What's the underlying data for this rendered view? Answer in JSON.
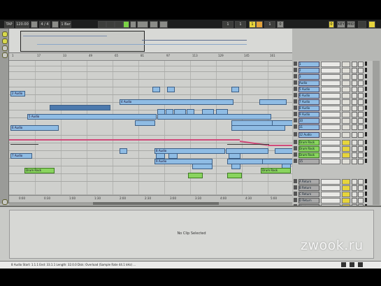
{
  "topbar": {
    "buttons_left": [
      "TAP",
      "120.00",
      "",
      "4 / 4",
      "",
      "1 Bar",
      "",
      "",
      ""
    ],
    "buttons_mid": [
      "",
      "",
      "",
      "",
      "",
      "",
      "",
      "",
      "",
      ""
    ],
    "buttons_right": [
      "1",
      "1",
      "1",
      "",
      "1",
      "0",
      "0",
      "",
      "",
      "KEY",
      "MIDI"
    ]
  },
  "ruler": {
    "ticks": [
      "1",
      "17",
      "33",
      "49",
      "65",
      "81",
      "97",
      "113",
      "129",
      "145",
      "161"
    ]
  },
  "bottom_ruler": {
    "ticks": [
      "0:00",
      "0:30",
      "1:00",
      "1:30",
      "2:00",
      "2:30",
      "3:00",
      "3:30",
      "4:00",
      "4:30",
      "5:00"
    ]
  },
  "clips": {
    "row1": [
      "",
      "",
      ""
    ],
    "row2": [
      "2 Audio"
    ],
    "row3": [
      "",
      "4 Audio",
      ""
    ],
    "row4": [
      "5 Audio",
      "",
      "",
      "",
      "",
      "",
      "",
      ""
    ],
    "row5": [
      "6 Audio",
      "",
      "",
      "",
      ""
    ],
    "row6": [
      "7 Audio",
      "",
      ""
    ],
    "row7": [
      "8 Audio",
      "",
      "",
      "",
      "",
      ""
    ],
    "row8": [
      "9 Audio",
      "",
      "",
      "",
      "",
      ""
    ],
    "row9": [
      "",
      "",
      "",
      ""
    ],
    "row10": [
      "Drum Rack",
      "",
      "",
      "Drum Rack"
    ]
  },
  "mixer": {
    "tracks": [
      {
        "name": "1",
        "color": "blue"
      },
      {
        "name": "2",
        "color": "blue"
      },
      {
        "name": "3",
        "color": "blue"
      },
      {
        "name": "Audio",
        "color": "blue"
      },
      {
        "name": "5 Audio",
        "color": "blue"
      },
      {
        "name": "6 Audio",
        "color": "blue"
      },
      {
        "name": "7 Audio",
        "color": "blue"
      },
      {
        "name": "8 Audio",
        "color": "blue"
      },
      {
        "name": "9 Audio",
        "color": "blue"
      },
      {
        "name": "10",
        "color": "blue"
      },
      {
        "name": "11",
        "color": "blue"
      },
      {
        "name": "12 Audio",
        "color": "blue"
      },
      {
        "name": "Drum Rack",
        "color": "green"
      },
      {
        "name": "Drum Rack",
        "color": "green"
      },
      {
        "name": "Drum Rack",
        "color": "green"
      },
      {
        "name": "15",
        "color": "gray"
      },
      {
        "name": "A Return",
        "color": "gray"
      },
      {
        "name": "B Return",
        "color": "gray"
      },
      {
        "name": "C Return",
        "color": "gray"
      },
      {
        "name": "D Return",
        "color": "gray"
      },
      {
        "name": "Master",
        "color": "gray"
      }
    ]
  },
  "detail": {
    "message": "No Clip Selected"
  },
  "status": {
    "text": "8 Audio  Start: 1.1.1  End: 33.1.1  Length: 32.0.0  Disk: Overload (Sample Rate 44.1 kHz) ..."
  },
  "watermark": "zwook.ru",
  "colors": {
    "clip_blue": "#8fbce4",
    "clip_green": "#89d45e",
    "automation": "#d14a7a",
    "arrangement_bg": "#cfd0cd",
    "topbar": "#1d1e1e"
  }
}
